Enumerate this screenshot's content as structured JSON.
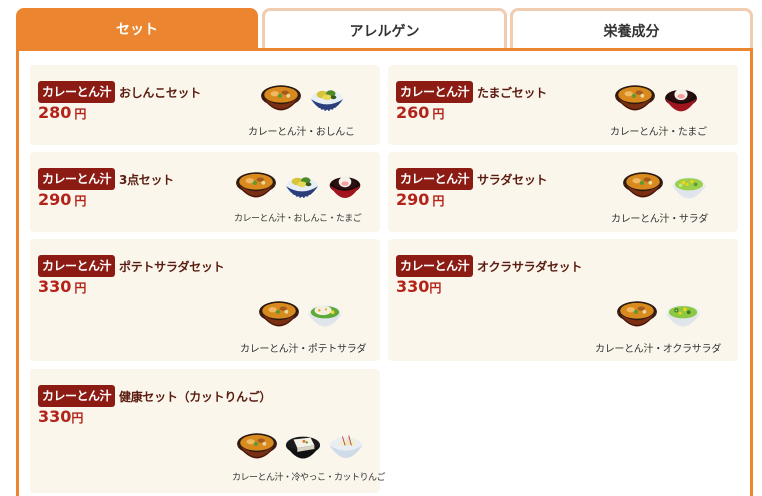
{
  "tabs": [
    {
      "label": "セット",
      "active": true
    },
    {
      "label": "アレルゲン",
      "active": false
    },
    {
      "label": "栄養成分",
      "active": false
    }
  ],
  "colors": {
    "accent": "#ec8530",
    "badge": "#8c1c13",
    "price": "#b3231a",
    "card": "#fbf6ec"
  },
  "cards": [
    {
      "badge": "カレーとん汁",
      "name": "おしんこセット",
      "price": "280",
      "unit": "円",
      "caption": "カレーとん汁・おしんこ",
      "items": [
        "curry-tonjiru-bowl-icon",
        "oshinko-bowl-icon"
      ]
    },
    {
      "badge": "カレーとん汁",
      "name": "たまごセット",
      "price": "260",
      "unit": "円",
      "caption": "カレーとん汁・たまご",
      "items": [
        "curry-tonjiru-bowl-icon",
        "egg-bowl-icon"
      ]
    },
    {
      "badge": "カレーとん汁",
      "name": "3点セット",
      "price": "290",
      "unit": "円",
      "caption": "カレーとん汁・おしんこ・たまご",
      "items": [
        "curry-tonjiru-bowl-icon",
        "oshinko-bowl-icon",
        "egg-bowl-icon"
      ]
    },
    {
      "badge": "カレーとん汁",
      "name": "サラダセット",
      "price": "290",
      "unit": "円",
      "caption": "カレーとん汁・サラダ",
      "items": [
        "curry-tonjiru-bowl-icon",
        "salad-bowl-icon"
      ]
    },
    {
      "badge": "カレーとん汁",
      "name": "ポテトサラダセット",
      "price": "330",
      "unit": "円",
      "caption": "カレーとん汁・ポテトサラダ",
      "items": [
        "curry-tonjiru-bowl-icon",
        "potato-salad-bowl-icon"
      ]
    },
    {
      "badge": "カレーとん汁",
      "name": "オクラサラダセット",
      "price": "330",
      "unit": "円",
      "caption": "カレーとん汁・オクラサラダ",
      "items": [
        "curry-tonjiru-bowl-icon",
        "okra-salad-bowl-icon"
      ]
    },
    {
      "badge": "カレーとん汁",
      "name": "健康セット（カットりんご）",
      "price": "330",
      "unit": "円",
      "caption": "カレーとん汁・冷やっこ・カットりんご",
      "items": [
        "curry-tonjiru-bowl-icon",
        "hiyayakko-bowl-icon",
        "cut-apple-bowl-icon"
      ]
    }
  ]
}
